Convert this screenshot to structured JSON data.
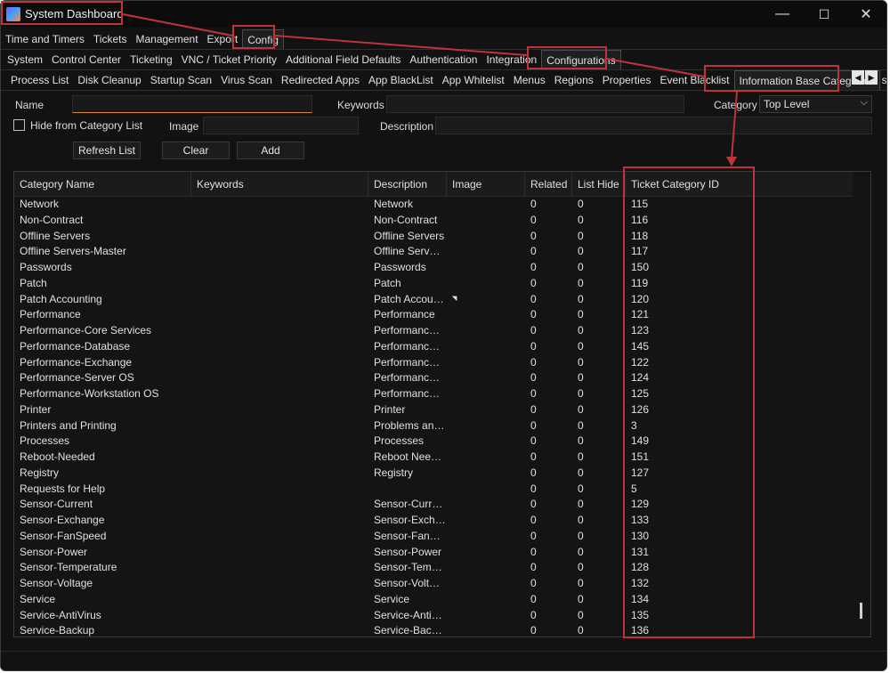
{
  "window": {
    "title": "System Dashboard",
    "minimize": "—",
    "maximize": "☐",
    "close": "✕"
  },
  "menu_row": [
    "Time and Timers",
    "Tickets",
    "Management",
    "Export",
    "Config"
  ],
  "config_row": [
    "System",
    "Control Center",
    "Ticketing",
    "VNC / Ticket Priority",
    "Additional Field Defaults",
    "Authentication",
    "Integration",
    "Configurations"
  ],
  "config_sub_row": [
    "Process List",
    "Disk Cleanup",
    "Startup Scan",
    "Virus Scan",
    "Redirected Apps",
    "App BlackList",
    "App Whitelist",
    "Menus",
    "Regions",
    "Properties",
    "Event Blacklist",
    "Information Base Categories",
    "s"
  ],
  "active": {
    "menu": "Config",
    "config": "Configurations",
    "sub": "Information Base Categories"
  },
  "form": {
    "name_label": "Name",
    "name_value": "",
    "keywords_label": "Keywords",
    "keywords_value": "",
    "category_label": "Category",
    "category_value": "Top Level",
    "hide_label": "Hide from Category List",
    "image_label": "Image",
    "image_value": "",
    "description_label": "Description",
    "description_value": "",
    "refresh_label": "Refresh List",
    "clear_label": "Clear",
    "add_label": "Add"
  },
  "table": {
    "columns": [
      "Category Name",
      "Keywords",
      "Description",
      "Image",
      "Related",
      "List Hide",
      "Ticket Category ID"
    ],
    "rows": [
      [
        "Network",
        "",
        "Network",
        "",
        "0",
        "0",
        "115"
      ],
      [
        "Non-Contract",
        "",
        "Non-Contract",
        "",
        "0",
        "0",
        "116"
      ],
      [
        "Offline Servers",
        "",
        "Offline Servers",
        "",
        "0",
        "0",
        "118"
      ],
      [
        "Offline Servers-Master",
        "",
        "Offline Serv…",
        "",
        "0",
        "0",
        "117"
      ],
      [
        "Passwords",
        "",
        "Passwords",
        "",
        "0",
        "0",
        "150"
      ],
      [
        "Patch",
        "",
        "Patch",
        "",
        "0",
        "0",
        "119"
      ],
      [
        "Patch Accounting",
        "",
        "Patch Accou…",
        "",
        "0",
        "0",
        "120"
      ],
      [
        "Performance",
        "",
        "Performance",
        "",
        "0",
        "0",
        "121"
      ],
      [
        "Performance-Core Services",
        "",
        "Performanc…",
        "",
        "0",
        "0",
        "123"
      ],
      [
        "Performance-Database",
        "",
        "Performanc…",
        "",
        "0",
        "0",
        "145"
      ],
      [
        "Performance-Exchange",
        "",
        "Performanc…",
        "",
        "0",
        "0",
        "122"
      ],
      [
        "Performance-Server OS",
        "",
        "Performanc…",
        "",
        "0",
        "0",
        "124"
      ],
      [
        "Performance-Workstation OS",
        "",
        "Performanc…",
        "",
        "0",
        "0",
        "125"
      ],
      [
        "Printer",
        "",
        "Printer",
        "",
        "0",
        "0",
        "126"
      ],
      [
        "Printers and Printing",
        "",
        "Problems an…",
        "",
        "0",
        "0",
        "3"
      ],
      [
        "Processes",
        "",
        "Processes",
        "",
        "0",
        "0",
        "149"
      ],
      [
        "Reboot-Needed",
        "",
        "Reboot Nee…",
        "",
        "0",
        "0",
        "151"
      ],
      [
        "Registry",
        "",
        "Registry",
        "",
        "0",
        "0",
        "127"
      ],
      [
        "Requests for Help",
        "",
        "",
        "",
        "0",
        "0",
        "5"
      ],
      [
        "Sensor-Current",
        "",
        "Sensor-Curr…",
        "",
        "0",
        "0",
        "129"
      ],
      [
        "Sensor-Exchange",
        "",
        "Sensor-Exch…",
        "",
        "0",
        "0",
        "133"
      ],
      [
        "Sensor-FanSpeed",
        "",
        "Sensor-Fan…",
        "",
        "0",
        "0",
        "130"
      ],
      [
        "Sensor-Power",
        "",
        "Sensor-Power",
        "",
        "0",
        "0",
        "131"
      ],
      [
        "Sensor-Temperature",
        "",
        "Sensor-Tem…",
        "",
        "0",
        "0",
        "128"
      ],
      [
        "Sensor-Voltage",
        "",
        "Sensor-Volt…",
        "",
        "0",
        "0",
        "132"
      ],
      [
        "Service",
        "",
        "Service",
        "",
        "0",
        "0",
        "134"
      ],
      [
        "Service-AntiVirus",
        "",
        "Service-Anti…",
        "",
        "0",
        "0",
        "135"
      ],
      [
        "Service-Backup",
        "",
        "Service-Bac…",
        "",
        "0",
        "0",
        "136"
      ]
    ]
  },
  "colors": {
    "annotation": "#c0323c",
    "background": "#121212",
    "focus_underline": "#d98b3a"
  },
  "icons": {
    "app": "app-icon",
    "scroll_left": "chevron-left-icon",
    "scroll_right": "chevron-right-icon",
    "dropdown": "chevron-down-icon"
  }
}
